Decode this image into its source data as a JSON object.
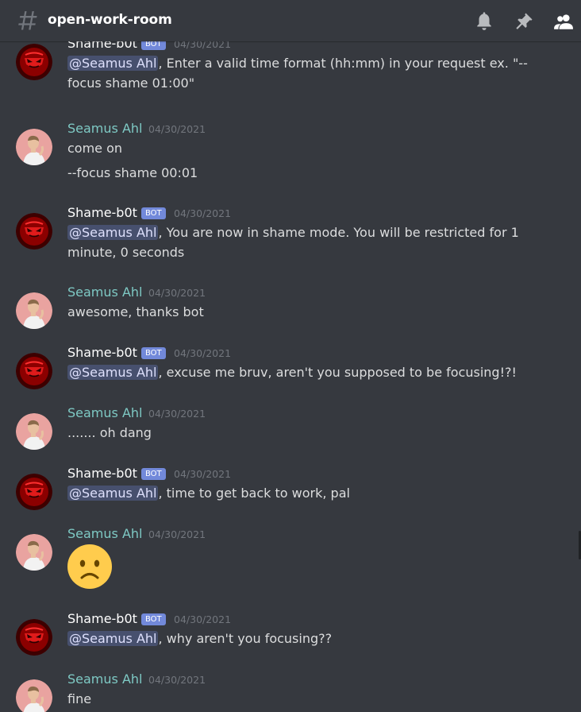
{
  "header": {
    "channel": "open-work-room",
    "icons": [
      "hash-icon",
      "bell-icon",
      "pin-icon",
      "members-icon"
    ]
  },
  "colors": {
    "background": "#36393f",
    "bot_name": "#ffffff",
    "user_name": "#7ec9c4",
    "bot_badge": "#7289da",
    "mention_bg": "#4a5080"
  },
  "messages": [
    {
      "author": "Shame-b0t",
      "bot": true,
      "badge": "BOT",
      "time": "04/30/2021",
      "mention": "@Seamus Ahl",
      "lines": [
        ", Enter a valid time format (hh:mm) in your request ex. \"--",
        "focus shame 01:00\""
      ]
    },
    {
      "author": "Seamus Ahl",
      "bot": false,
      "time": "04/30/2021",
      "lines": [
        "come on",
        "--focus shame 00:01"
      ]
    },
    {
      "author": "Shame-b0t",
      "bot": true,
      "badge": "BOT",
      "time": "04/30/2021",
      "mention": "@Seamus Ahl",
      "lines": [
        ", You are now in shame mode. You will be restricted for 1",
        "minute, 0 seconds"
      ]
    },
    {
      "author": "Seamus Ahl",
      "bot": false,
      "time": "04/30/2021",
      "lines": [
        "awesome, thanks bot"
      ]
    },
    {
      "author": "Shame-b0t",
      "bot": true,
      "badge": "BOT",
      "time": "04/30/2021",
      "mention": "@Seamus Ahl",
      "lines": [
        ", excuse me bruv, aren't you supposed to be focusing!?!"
      ]
    },
    {
      "author": "Seamus Ahl",
      "bot": false,
      "time": "04/30/2021",
      "lines": [
        "....... oh dang"
      ]
    },
    {
      "author": "Shame-b0t",
      "bot": true,
      "badge": "BOT",
      "time": "04/30/2021",
      "mention": "@Seamus Ahl",
      "lines": [
        ", time to get back to work, pal"
      ]
    },
    {
      "author": "Seamus Ahl",
      "bot": false,
      "time": "04/30/2021",
      "emoji": "frowning-face-emoji"
    },
    {
      "author": "Shame-b0t",
      "bot": true,
      "badge": "BOT",
      "time": "04/30/2021",
      "mention": "@Seamus Ahl",
      "lines": [
        ", why aren't you focusing??"
      ]
    },
    {
      "author": "Seamus Ahl",
      "bot": false,
      "time": "04/30/2021",
      "lines": [
        "fine"
      ]
    }
  ]
}
